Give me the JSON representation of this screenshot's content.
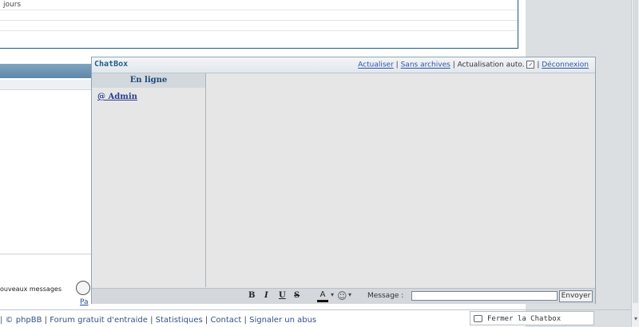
{
  "background": {
    "top_text": "jours",
    "new_messages_label": "ouveaux messages",
    "pa_link": "Pa"
  },
  "footer": {
    "items": [
      "| © phpBB",
      "Forum gratuit d'entraide",
      "Statistiques",
      "Contact",
      "Signaler un abus"
    ],
    "separator": "|"
  },
  "close_chatbox": {
    "label": "Fermer la Chatbox",
    "icon": "chat-bubble-icon"
  },
  "chatbox": {
    "title": "ChatBox",
    "links": {
      "refresh": "Actualiser",
      "no_archives": "Sans archives",
      "auto_refresh_label": "Actualisation auto.",
      "auto_refresh_checked": "✓",
      "logout": "Déconnexion",
      "separator": "|"
    },
    "online": {
      "heading": "En ligne",
      "users": [
        "@ Admin"
      ]
    },
    "toolbar": {
      "bold": "B",
      "italic": "I",
      "underline": "U",
      "strike": "S",
      "color": "A",
      "caret": "▾",
      "smiley": "☺",
      "message_label": "Message :",
      "message_value": "",
      "send": "Envoyer"
    }
  },
  "colors": {
    "title": "#1e5f8c",
    "link": "#2c55a8",
    "panel_bg": "#e6e6e6"
  }
}
